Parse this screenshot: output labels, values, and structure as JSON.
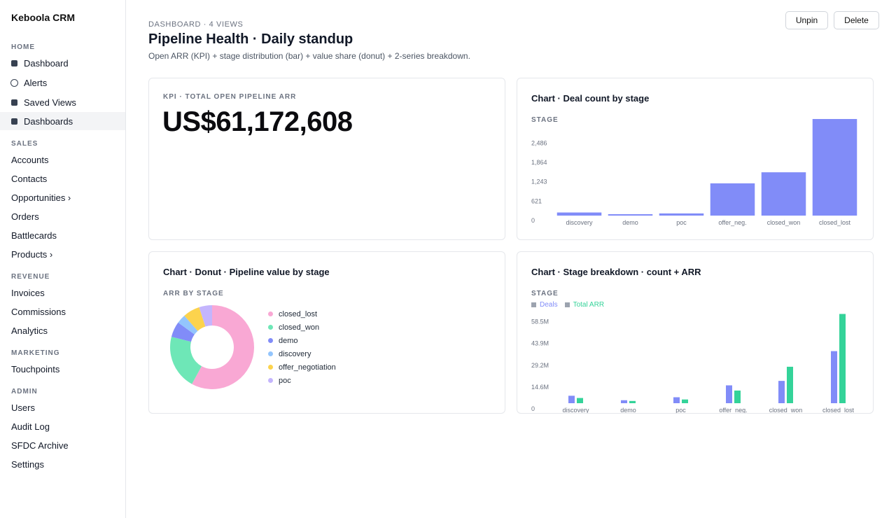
{
  "app": {
    "title": "Keboola CRM"
  },
  "sidebar": {
    "sections": [
      {
        "label": "HOME",
        "items": [
          {
            "label": "Dashboard",
            "icon": "square-icon",
            "active": false
          },
          {
            "label": "Alerts",
            "icon": "circle-icon",
            "active": false
          },
          {
            "label": "Saved Views",
            "icon": "square-icon",
            "active": false
          },
          {
            "label": "Dashboards",
            "icon": "square-icon",
            "active": true
          }
        ]
      },
      {
        "label": "SALES",
        "items": [
          {
            "label": "Accounts"
          },
          {
            "label": "Contacts"
          },
          {
            "label": "Opportunities ›"
          },
          {
            "label": "Orders"
          },
          {
            "label": "Battlecards"
          },
          {
            "label": "Products ›"
          }
        ]
      },
      {
        "label": "REVENUE",
        "items": [
          {
            "label": "Invoices"
          },
          {
            "label": "Commissions"
          },
          {
            "label": "Analytics"
          }
        ]
      },
      {
        "label": "MARKETING",
        "items": [
          {
            "label": "Touchpoints"
          }
        ]
      },
      {
        "label": "ADMIN",
        "items": [
          {
            "label": "Users"
          },
          {
            "label": "Audit Log"
          },
          {
            "label": "SFDC Archive"
          },
          {
            "label": "Settings"
          }
        ]
      }
    ]
  },
  "header": {
    "breadcrumb": "DASHBOARD · 4 VIEWS",
    "title": "Pipeline Health · Daily standup",
    "subtitle": "Open ARR (KPI) + stage distribution (bar) + value share (donut) + 2-series breakdown.",
    "unpin_label": "Unpin",
    "delete_label": "Delete"
  },
  "kpi": {
    "label": "KPI · TOTAL OPEN PIPELINE ARR",
    "value": "US$61,172,608"
  },
  "colors": {
    "bar": "#818cf8",
    "deals": "#818cf8",
    "arr": "#34d399"
  },
  "chart_data": [
    {
      "type": "bar",
      "title": "Chart · Deal count by stage",
      "subtitle": "STAGE",
      "categories": [
        "discovery",
        "demo",
        "poc",
        "offer_neg.",
        "closed_won",
        "closed_lost"
      ],
      "values": [
        100,
        45,
        70,
        1035,
        1390,
        3100
      ],
      "yticks": [
        "0",
        "621",
        "1,243",
        "1,864",
        "2,486"
      ],
      "ytick_values": [
        0,
        621,
        1243,
        1864,
        2486
      ],
      "ylim": [
        0,
        3100
      ]
    },
    {
      "type": "pie",
      "title": "Chart · Donut · Pipeline value by stage",
      "subtitle": "ARR BY STAGE",
      "labels": [
        "closed_lost",
        "closed_won",
        "demo",
        "discovery",
        "offer_negotiation",
        "poc"
      ],
      "values": [
        58,
        21,
        6,
        3.5,
        6.5,
        5
      ],
      "colors": [
        "#f9a8d4",
        "#6ee7b7",
        "#818cf8",
        "#93c5fd",
        "#fcd34d",
        "#c4b5fd"
      ]
    },
    {
      "type": "bar",
      "title": "Chart · Stage breakdown · count + ARR",
      "subtitle": "STAGE",
      "categories": [
        "discovery",
        "demo",
        "poc",
        "offer_neg.",
        "closed_won",
        "closed_lost"
      ],
      "series": [
        {
          "name": "Deals",
          "values": [
            5,
            2,
            4,
            12,
            15,
            35
          ]
        },
        {
          "name": "Total ARR",
          "values": [
            3.5,
            1.5,
            2.5,
            8.5,
            24.5,
            60
          ]
        }
      ],
      "yticks": [
        "0",
        "14.6M",
        "29.2M",
        "43.9M",
        "58.5M"
      ],
      "ytick_values": [
        0,
        14.6,
        29.2,
        43.9,
        58.5
      ],
      "ylim": [
        0,
        64
      ],
      "ylabel_unit": "M"
    }
  ]
}
